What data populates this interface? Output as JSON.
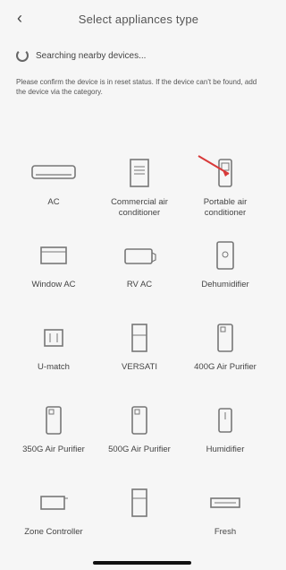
{
  "header": {
    "title": "Select appliances type",
    "back_icon": "back-icon"
  },
  "search": {
    "text": "Searching nearby devices..."
  },
  "hint": {
    "text": "Please confirm the device is in reset status. If the device can't be found, add the device via the category."
  },
  "appliances": [
    {
      "label": "AC",
      "icon": "split-ac-icon"
    },
    {
      "label": "Commercial air conditioner",
      "icon": "commercial-ac-icon"
    },
    {
      "label": "Portable air conditioner",
      "icon": "portable-ac-icon"
    },
    {
      "label": "Window AC",
      "icon": "window-ac-icon"
    },
    {
      "label": "RV AC",
      "icon": "rv-ac-icon"
    },
    {
      "label": "Dehumidifier",
      "icon": "dehumidifier-icon"
    },
    {
      "label": "U-match",
      "icon": "u-match-icon"
    },
    {
      "label": "VERSATI",
      "icon": "versati-icon"
    },
    {
      "label": "400G Air Purifier",
      "icon": "air-purifier-400g-icon"
    },
    {
      "label": "350G Air Purifier",
      "icon": "air-purifier-350g-icon"
    },
    {
      "label": "500G Air Purifier",
      "icon": "air-purifier-500g-icon"
    },
    {
      "label": "Humidifier",
      "icon": "humidifier-icon"
    },
    {
      "label": "Zone Controller",
      "icon": "zone-controller-icon"
    },
    {
      "label": "",
      "icon": "fridge-icon"
    },
    {
      "label": "Fresh",
      "icon": "fresh-air-icon"
    }
  ],
  "colors": {
    "background": "#f6f6f6",
    "text": "#444444",
    "icon": "#777777",
    "arrow": "#d83a3a"
  }
}
